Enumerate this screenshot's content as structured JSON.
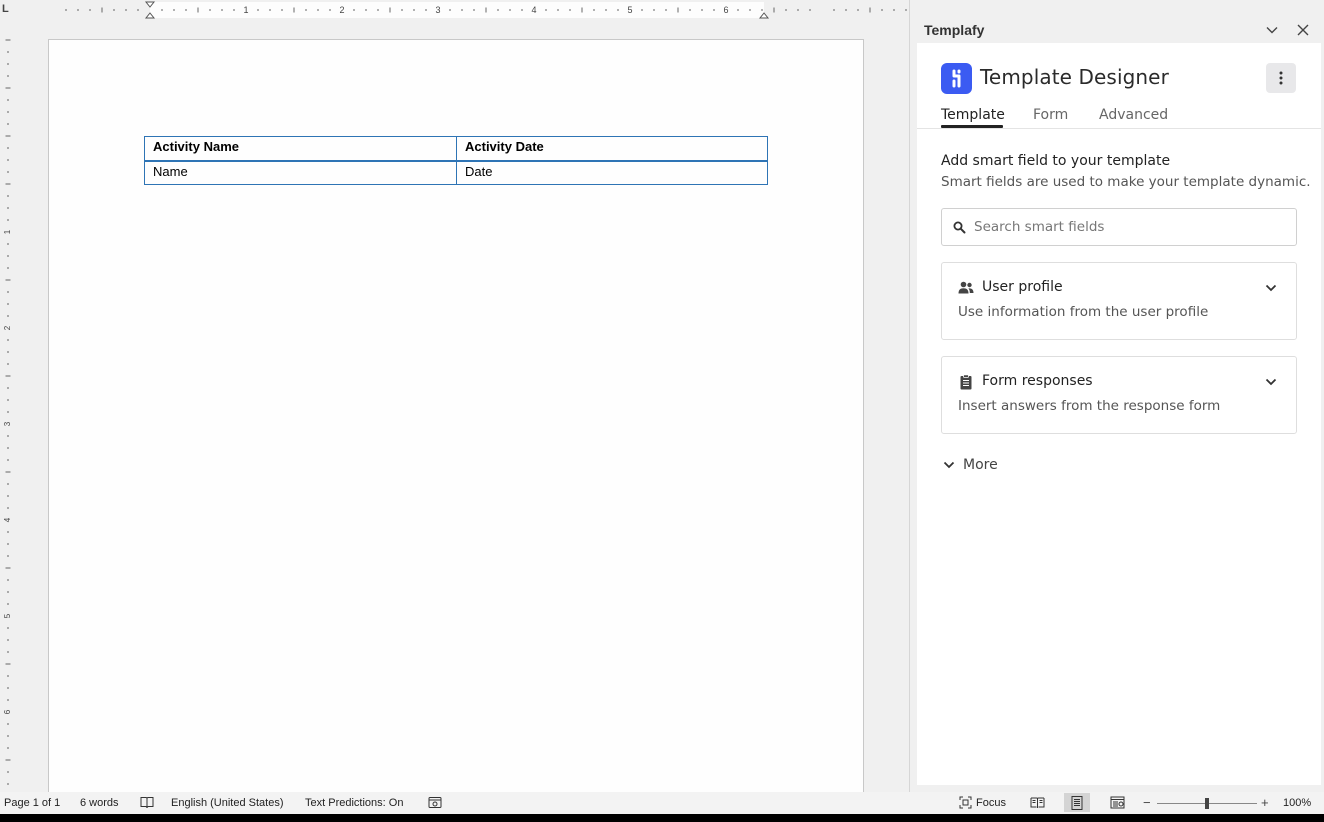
{
  "document": {
    "table": {
      "headers": [
        "Activity Name",
        "Activity Date"
      ],
      "rows": [
        [
          "Name",
          "Date"
        ]
      ]
    },
    "ruler": {
      "corner": "L",
      "h_numbers": [
        "1",
        "2",
        "3",
        "4",
        "5",
        "6"
      ],
      "v_numbers": [
        "1",
        "2",
        "3",
        "4",
        "5",
        "6"
      ]
    }
  },
  "pane": {
    "title": "Templafy",
    "brand_title": "Template Designer",
    "tabs": [
      {
        "label": "Template",
        "active": true
      },
      {
        "label": "Form",
        "active": false
      },
      {
        "label": "Advanced",
        "active": false
      }
    ],
    "section_heading": "Add smart field to your template",
    "section_subtitle": "Smart fields are used to make your template dynamic.",
    "search": {
      "placeholder": "Search smart fields",
      "value": ""
    },
    "cards": [
      {
        "title": "User profile",
        "description": "Use information from the user profile",
        "icon": "users-icon"
      },
      {
        "title": "Form responses",
        "description": "Insert answers from the response form",
        "icon": "clipboard-icon"
      }
    ],
    "more_label": "More",
    "accent_color": "#3b5bf2"
  },
  "status_bar": {
    "page": "Page 1 of 1",
    "words": "6 words",
    "language": "English (United States)",
    "text_predictions": "Text Predictions: On",
    "focus": "Focus",
    "zoom": "100%",
    "zoom_minus": "−",
    "zoom_plus": "+"
  }
}
